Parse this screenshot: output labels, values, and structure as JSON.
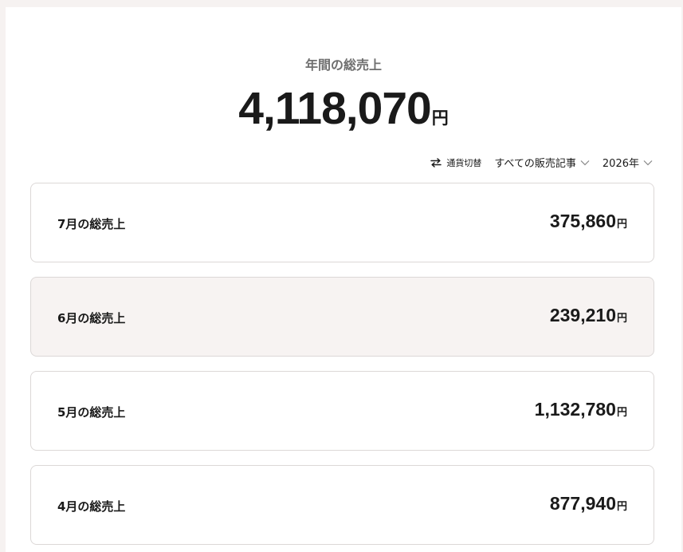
{
  "summary": {
    "label": "年間の総売上",
    "amount": "4,118,070",
    "unit": "円"
  },
  "filters": {
    "currency_toggle": "通貨切替",
    "article": "すべての販売記事",
    "year": "2026年"
  },
  "icons": {
    "swap": "swap-arrows-icon",
    "dropdown": "chevron-down-icon"
  },
  "colors": {
    "highlight_bg": "#f7f3f2",
    "border": "#dcd8d7",
    "muted_text": "#6f6f6f"
  },
  "months": [
    {
      "label": "7月の総売上",
      "amount": "375,860",
      "unit": "円"
    },
    {
      "label": "6月の総売上",
      "amount": "239,210",
      "unit": "円"
    },
    {
      "label": "5月の総売上",
      "amount": "1,132,780",
      "unit": "円"
    },
    {
      "label": "4月の総売上",
      "amount": "877,940",
      "unit": "円"
    }
  ]
}
